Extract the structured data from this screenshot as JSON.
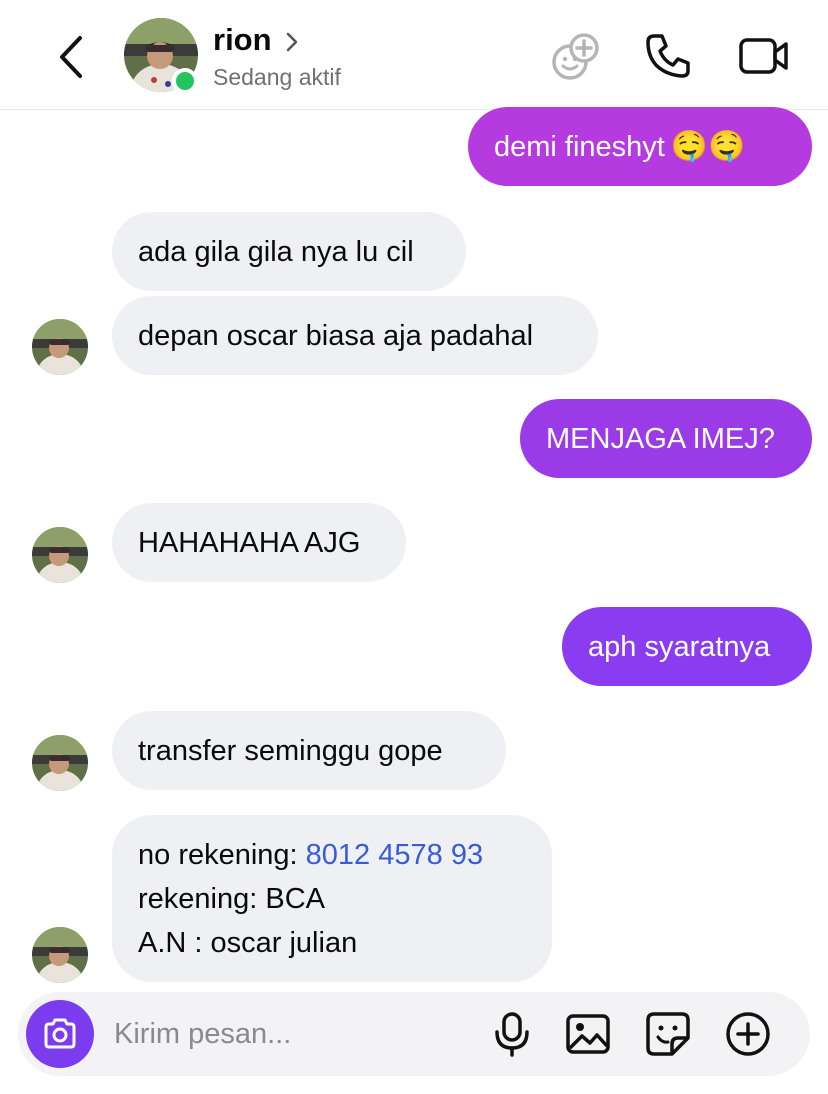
{
  "header": {
    "contact_name": "rion",
    "status": "Sedang aktif"
  },
  "messages": [
    {
      "side": "out",
      "text": "demi fineshyt",
      "emoji": "🤤🤤",
      "color": "#b53ae0"
    },
    {
      "side": "in",
      "text": "ada gila gila nya lu cil"
    },
    {
      "side": "in",
      "text": "depan oscar biasa aja padahal"
    },
    {
      "side": "out",
      "text": "MENJAGA IMEJ?",
      "color": "#9b3be8"
    },
    {
      "side": "in",
      "text": "HAHAHAHA AJG"
    },
    {
      "side": "out",
      "text": "aph syaratnya",
      "color": "#8a3cf0"
    },
    {
      "side": "in",
      "text": "transfer seminggu gope"
    },
    {
      "side": "in",
      "lines": [
        {
          "label": "no rekening: ",
          "link": "8012 4578 93"
        },
        {
          "label": "rekening: BCA"
        },
        {
          "label": "A.N : oscar julian"
        }
      ]
    }
  ],
  "composer": {
    "placeholder": "Kirim pesan..."
  },
  "colors": {
    "accent": "#7b3cf0",
    "incoming_bubble": "#eef0f3",
    "online": "#22c55e",
    "link": "#3a5bd9"
  },
  "icons": [
    "back-chevron-icon",
    "avatar-add-icon",
    "phone-icon",
    "video-camera-icon",
    "camera-icon",
    "microphone-icon",
    "gallery-icon",
    "sticker-icon",
    "plus-circle-icon"
  ]
}
